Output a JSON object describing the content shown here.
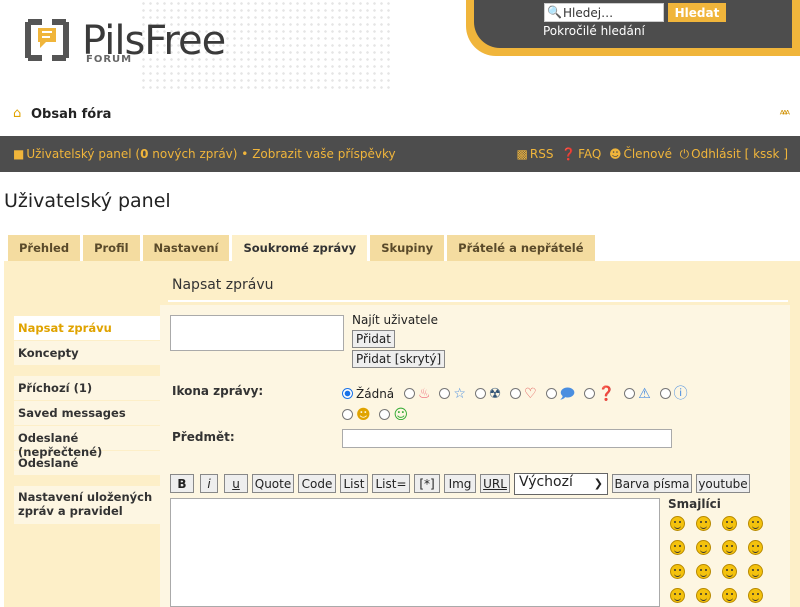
{
  "header": {
    "logo_text": "PilsFree",
    "logo_sub": "FORUM",
    "search_placeholder": "Hledej…",
    "search_button": "Hledat",
    "advanced_search": "Pokročilé hledání"
  },
  "breadcrumb": {
    "home": "Obsah fóra"
  },
  "navbar": {
    "ucp_prefix": "Uživatelský panel (",
    "new_count": "0",
    "ucp_suffix": " nových zpráv)",
    "sep": "•",
    "your_posts": "Zobrazit vaše příspěvky",
    "rss": "RSS",
    "faq": "FAQ",
    "members": "Členové",
    "logout": "Odhlásit [ kssk ]"
  },
  "page_title": "Uživatelský panel",
  "tabs": [
    "Přehled",
    "Profil",
    "Nastavení",
    "Soukromé zprávy",
    "Skupiny",
    "Přátelé a nepřátelé"
  ],
  "sidebar": {
    "group1": [
      "Napsat zprávu",
      "Koncepty"
    ],
    "group2": [
      "Příchozí (1)",
      "Saved messages",
      "Odeslané (nepřečtené)",
      "Odeslané"
    ],
    "group3": [
      "Nastavení uložených zpráv a pravidel"
    ]
  },
  "compose": {
    "title": "Napsat zprávu",
    "find_user": "Najít uživatele",
    "add": "Přidat",
    "add_hidden": "Přidat [skrytý]",
    "icon_label": "Ikona zprávy:",
    "icon_none": "Žádná",
    "subject_label": "Předmět:",
    "toolbar": [
      "B",
      "i",
      "u",
      "Quote",
      "Code",
      "List",
      "List=",
      "[*]",
      "Img",
      "URL"
    ],
    "font_select": "Výchozí",
    "font_color": "Barva písma",
    "youtube": "youtube",
    "smilies_title": "Smajlíci"
  },
  "colors": {
    "accent": "#f0b53b",
    "dark": "#4d4d4d",
    "panel": "#fdefc8"
  }
}
